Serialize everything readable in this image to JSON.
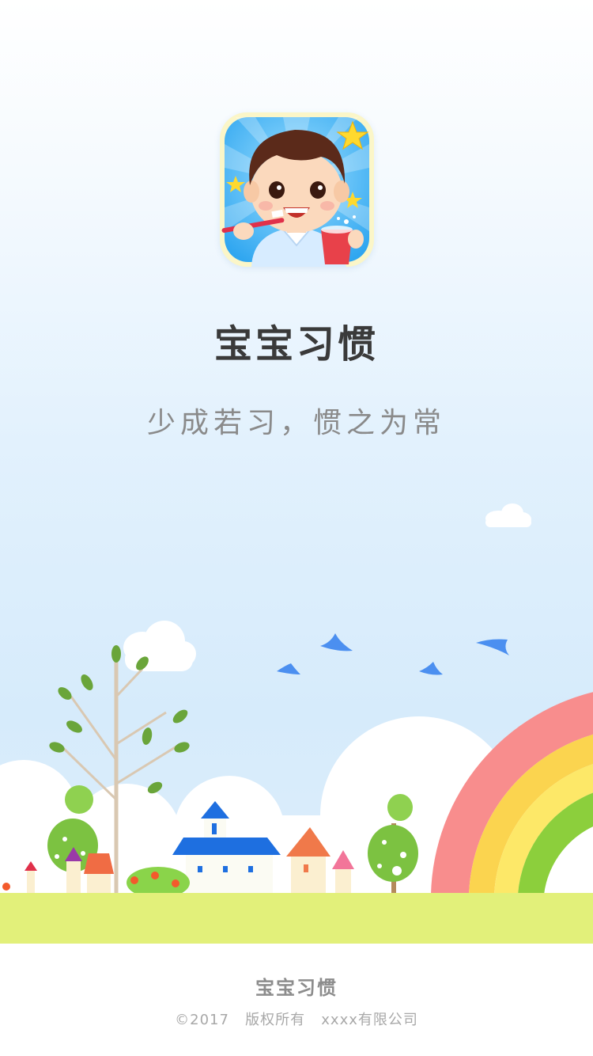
{
  "app": {
    "name": "宝宝习惯",
    "slogan": "少成若习，惯之为常"
  },
  "footer": {
    "name": "宝宝习惯",
    "copyright": "©2017   版权所有   xxxx有限公司"
  },
  "icons": {
    "app_icon": "boy-brushing-teeth-icon",
    "birds": "bird-icon",
    "rainbow": "rainbow-illustration"
  },
  "colors": {
    "title": "#3a3a3a",
    "slogan": "#8a8a8a",
    "grass": "#e2f07a",
    "sky": "#dcedfb"
  }
}
